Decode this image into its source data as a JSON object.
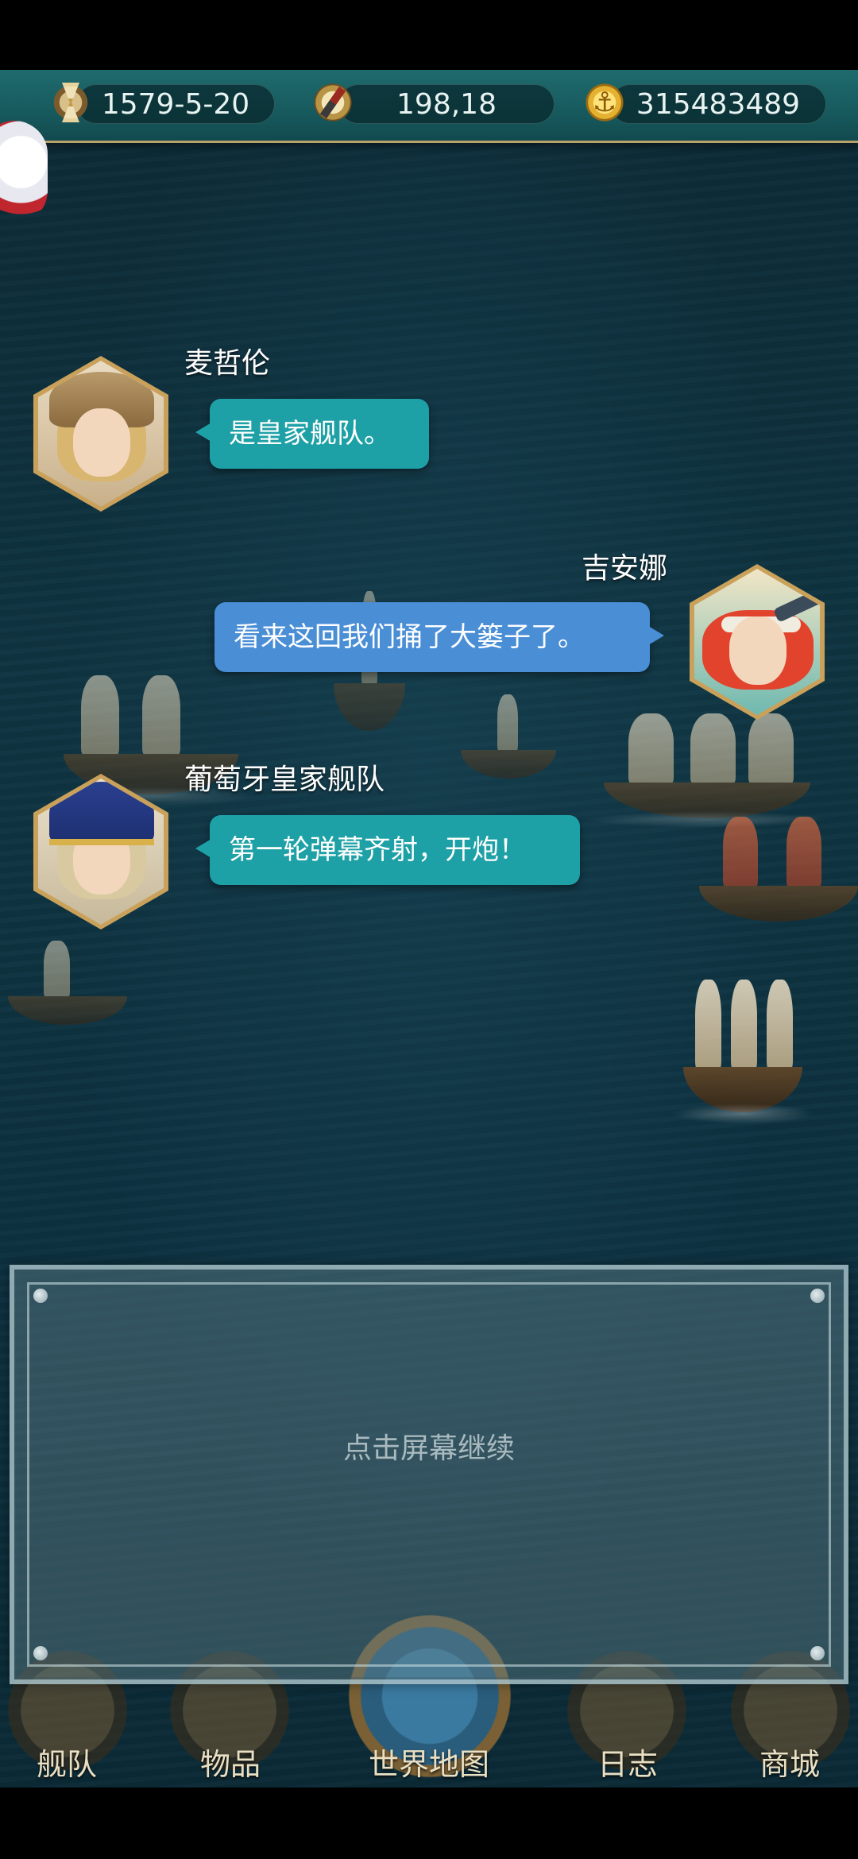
{
  "status": {
    "date": "1579-5-20",
    "coordinates": "198,18",
    "gold": "315483489",
    "icons": [
      "hourglass-icon",
      "compass-icon",
      "gold-coin-icon"
    ]
  },
  "dialogue": [
    {
      "speaker": "麦哲伦",
      "text": "是皇家舰队。",
      "bubble_color": "#1ea1a6"
    },
    {
      "speaker": "吉安娜",
      "text": "看来这回我们捅了大篓子了。",
      "bubble_color": "#4a8ed6"
    },
    {
      "speaker": "葡萄牙皇家舰队",
      "text": "第一轮弹幕齐射，开炮！",
      "bubble_color": "#1ea1a6"
    }
  ],
  "panel": {
    "hint": "点击屏幕继续"
  },
  "nav": {
    "items": [
      {
        "label": "舰队",
        "icon": "ship-wheel-icon"
      },
      {
        "label": "物品",
        "icon": "bag-icon"
      },
      {
        "label": "世界地图",
        "icon": "globe-icon"
      },
      {
        "label": "日志",
        "icon": "scroll-icon"
      },
      {
        "label": "商城",
        "icon": "treasure-chest-icon"
      }
    ]
  },
  "colors": {
    "status_bar": "#1f6a6d",
    "sea": "#0f3441",
    "teal_bubble": "#1ea1a6",
    "blue_bubble": "#4a8ed6"
  }
}
